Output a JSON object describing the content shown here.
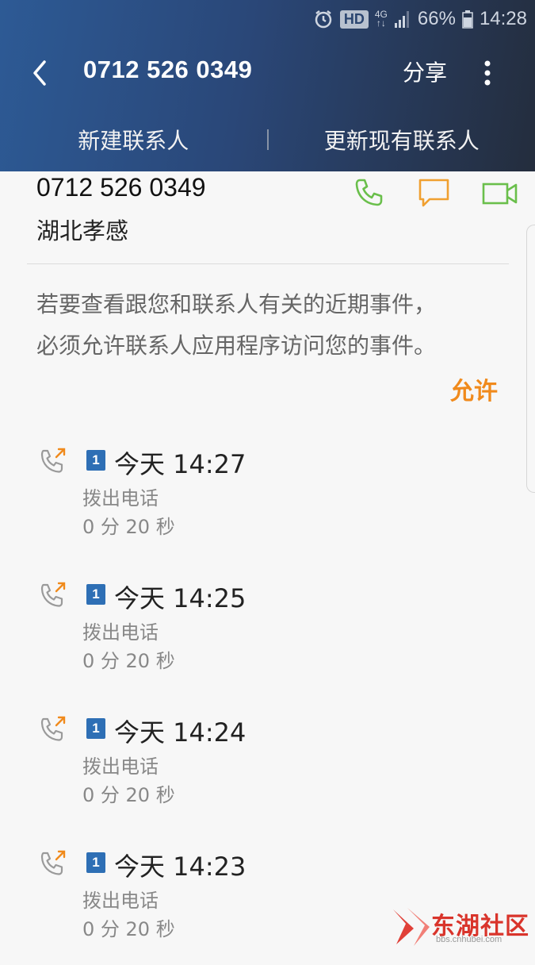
{
  "status_bar": {
    "hd": "HD",
    "network_top": "4G",
    "network_bottom": "↑↓",
    "battery": "66%",
    "time": "14:28"
  },
  "toolbar": {
    "title": "0712 526 0349",
    "share": "分享"
  },
  "actions": {
    "new_contact": "新建联系人",
    "update_contact": "更新现有联系人"
  },
  "contact": {
    "number": "0712 526 0349",
    "location": "湖北孝感"
  },
  "notice": {
    "line1": "若要查看跟您和联系人有关的近期事件，",
    "line2": "必须允许联系人应用程序访问您的事件。",
    "allow": "允许"
  },
  "call_log": [
    {
      "sim": "1",
      "time": "今天 14:27",
      "type": "拨出电话",
      "duration": "0 分 20 秒"
    },
    {
      "sim": "1",
      "time": "今天 14:25",
      "type": "拨出电话",
      "duration": "0 分 20 秒"
    },
    {
      "sim": "1",
      "time": "今天 14:24",
      "type": "拨出电话",
      "duration": "0 分 20 秒"
    },
    {
      "sim": "1",
      "time": "今天 14:23",
      "type": "拨出电话",
      "duration": "0 分 20 秒"
    }
  ],
  "watermark": {
    "name": "东湖社区",
    "url": "bbs.cnhubei.com"
  },
  "colors": {
    "header_start": "#2d5a95",
    "header_end": "#242d3d",
    "call_green": "#6abf4b",
    "message_orange": "#f0a030",
    "allow_orange": "#f08a1c",
    "sim_blue": "#2e6fb5"
  }
}
